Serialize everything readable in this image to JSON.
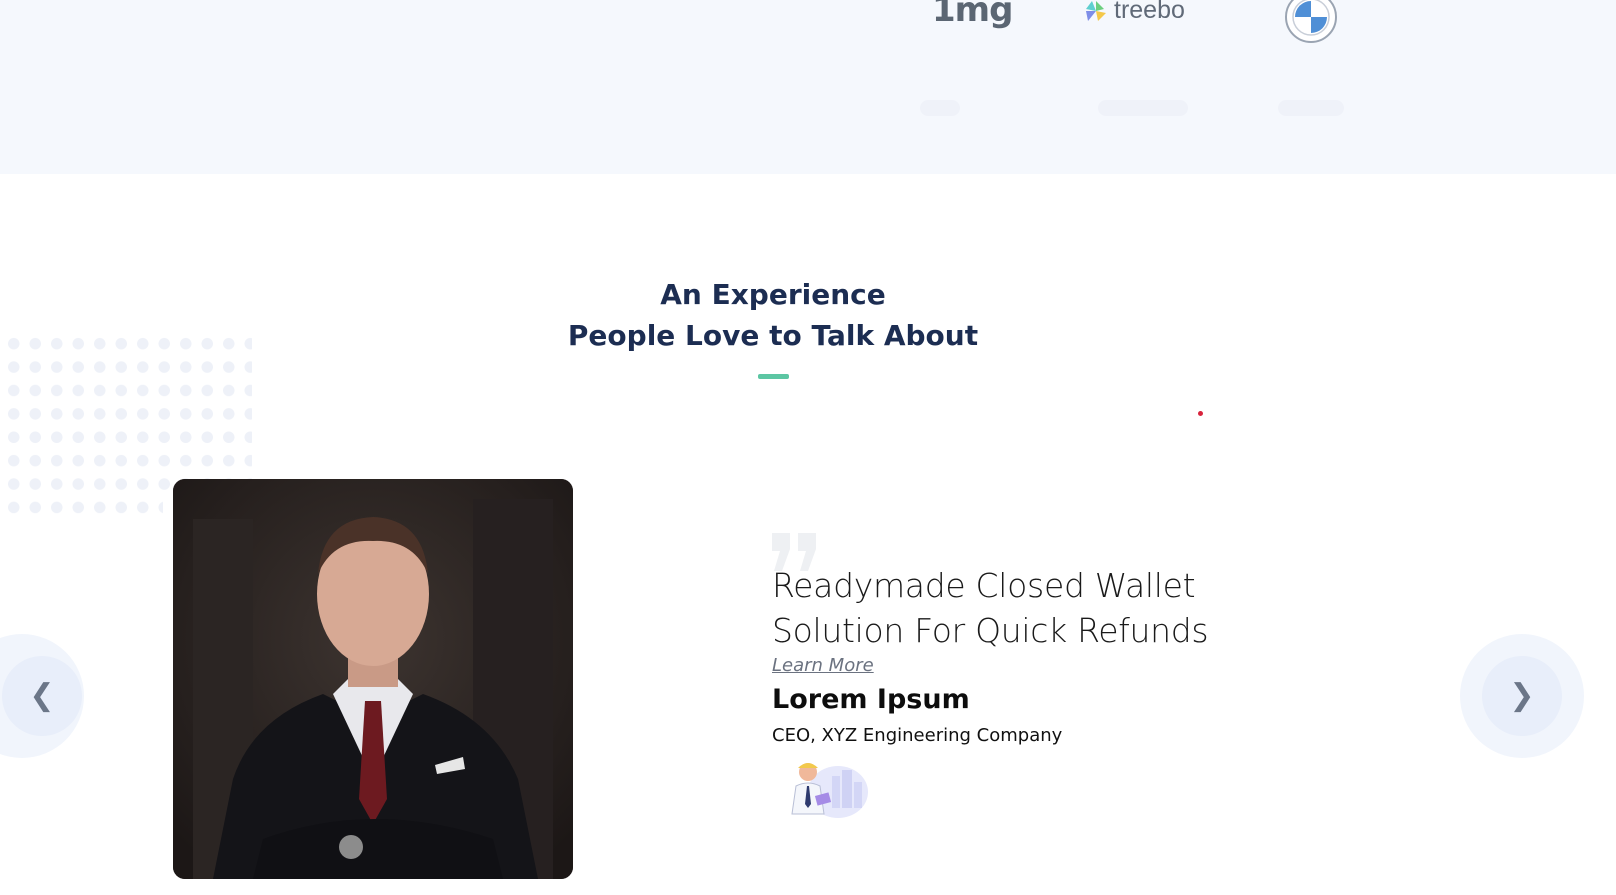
{
  "logos": {
    "brand1": "1mg",
    "brand2": "treebo"
  },
  "section": {
    "title_line1": "An Experience",
    "title_line2": "People Love to Talk About",
    "accent_color": "#5cc6a3",
    "title_color": "#1c2d52"
  },
  "testimonial": {
    "headline_line1": "Readymade Closed Wallet",
    "headline_line2": "Solution For Quick Refunds",
    "learn_more": "Learn More",
    "name": "Lorem Ipsum",
    "role": "CEO, XYZ Engineering Company"
  },
  "carousel": {
    "prev_icon": "chevron-left-icon",
    "next_icon": "chevron-right-icon"
  }
}
